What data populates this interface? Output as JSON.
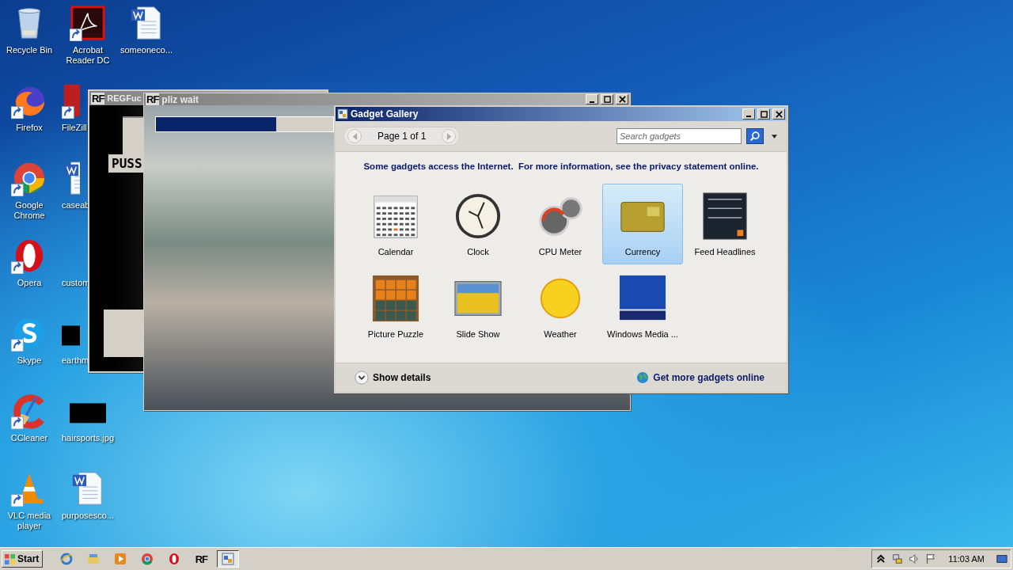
{
  "desktop_icons": [
    {
      "label": "Recycle Bin",
      "kind": "recycle-bin",
      "shortcut": false,
      "covered": false
    },
    {
      "label": "Firefox",
      "kind": "firefox",
      "shortcut": true,
      "covered": false
    },
    {
      "label": "Google Chrome",
      "kind": "chrome",
      "shortcut": true,
      "covered": false
    },
    {
      "label": "Opera",
      "kind": "opera",
      "shortcut": true,
      "covered": false
    },
    {
      "label": "Skype",
      "kind": "skype",
      "shortcut": true,
      "covered": false
    },
    {
      "label": "CCleaner",
      "kind": "ccleaner",
      "shortcut": true,
      "covered": false
    },
    {
      "label": "VLC media player",
      "kind": "vlc",
      "shortcut": true,
      "covered": false
    },
    {
      "label": "Acrobat Reader DC",
      "kind": "acrobat",
      "shortcut": true,
      "covered": false
    },
    {
      "label": "FileZill",
      "kind": "filezilla",
      "shortcut": true,
      "covered": true
    },
    {
      "label": "caseab",
      "kind": "word",
      "shortcut": false,
      "covered": true
    },
    {
      "label": "custom",
      "kind": "none",
      "covered": true
    },
    {
      "label": "earthm",
      "kind": "image",
      "shortcut": false,
      "covered": true
    },
    {
      "label": "hairsports.jpg",
      "kind": "image",
      "shortcut": false,
      "covered": false
    },
    {
      "label": "purposesco...",
      "kind": "word",
      "shortcut": false,
      "covered": false
    },
    {
      "label": "someoneco...",
      "kind": "word",
      "shortcut": false,
      "covered": false
    }
  ],
  "background_window": {
    "icon_text": "RF",
    "title": "REGFuc",
    "label": "PUSS"
  },
  "progress_window": {
    "icon_text": "RF",
    "title": "pliz wait",
    "progress": {
      "level": 0.68
    }
  },
  "gadget_gallery": {
    "title": "Gadget Gallery",
    "page": "Page 1 of 1",
    "search": {
      "placeholder": "Search gadgets"
    },
    "notice": "Some gadgets access the Internet.  For more information, see the privacy statement online.",
    "gadgets": [
      {
        "name": "Calendar",
        "kind": "calendar",
        "selected": false
      },
      {
        "name": "Clock",
        "kind": "clock",
        "selected": false
      },
      {
        "name": "CPU Meter",
        "kind": "cpu",
        "selected": false
      },
      {
        "name": "Currency",
        "kind": "currency",
        "selected": true
      },
      {
        "name": "Feed Headlines",
        "kind": "feed",
        "selected": false
      },
      {
        "name": "Picture Puzzle",
        "kind": "puzzle",
        "selected": false
      },
      {
        "name": "Slide Show",
        "kind": "slideshow",
        "selected": false
      },
      {
        "name": "Weather",
        "kind": "weather",
        "selected": false
      },
      {
        "name": "Windows Media ...",
        "kind": "media",
        "selected": false
      }
    ],
    "details_link": "Show details",
    "more_link": "Get more gadgets online"
  },
  "taskbar": {
    "start": "Start",
    "buttons": [
      {
        "kind": "ie",
        "active": false
      },
      {
        "kind": "explorer",
        "active": false
      },
      {
        "kind": "media-player",
        "active": false
      },
      {
        "kind": "chrome",
        "active": false
      },
      {
        "kind": "opera",
        "active": false
      },
      {
        "kind": "rf",
        "text": "RF",
        "active": false
      },
      {
        "kind": "gallery",
        "active": true
      }
    ],
    "clock": "11:03 AM"
  }
}
